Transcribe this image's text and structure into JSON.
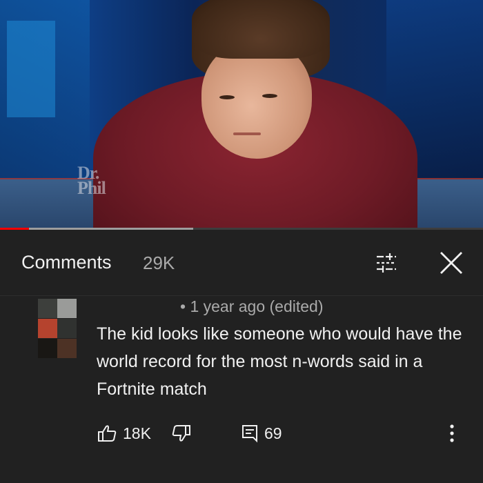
{
  "video": {
    "watermark": "Dr.\nPhil",
    "progress_played": 0.06,
    "progress_buffered": 0.4
  },
  "comments_panel": {
    "title": "Comments",
    "count": "29K",
    "filter_icon": "sort-filter-icon",
    "close_icon": "close-icon"
  },
  "comment": {
    "meta": "• 1 year ago (edited)",
    "text": "The kid looks like someone who would have the world record for the most n-words said in a Fortnite match",
    "likes": "18K",
    "replies": "69",
    "avatar_colors": [
      "#3d3f3c",
      "#9a9b99",
      "#b5432e",
      "#303230",
      "#191714",
      "#4d3225"
    ]
  },
  "colors": {
    "background": "#212121",
    "progress_red": "#ff0000",
    "text_primary": "#f1f1f1",
    "text_secondary": "#aaaaaa"
  }
}
